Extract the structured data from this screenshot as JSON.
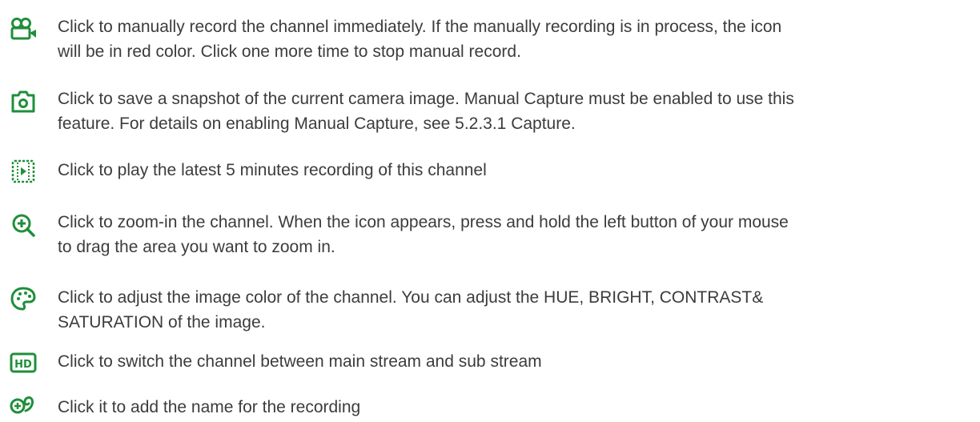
{
  "accent_color": "#1f8f3a",
  "items": [
    {
      "icon": "video-camera-record-icon",
      "text": "Click to manually record the channel immediately. If the manually recording is in process, the icon\nwill be in red color. Click one more time to stop manual record."
    },
    {
      "icon": "camera-snapshot-icon",
      "text": "Click to save a snapshot of the current camera image. Manual Capture must be enabled to use this\nfeature. For details on enabling Manual Capture, see 5.2.3.1 Capture."
    },
    {
      "icon": "instant-playback-icon",
      "text": "Click to play the latest 5 minutes recording of this channel"
    },
    {
      "icon": "zoom-in-icon",
      "text": "Click to zoom-in the channel. When the   icon appears, press and hold the left button of your mouse\nto drag the area you want to zoom in."
    },
    {
      "icon": "color-palette-icon",
      "text": "Click to adjust the image color of the channel. You can adjust the HUE, BRIGHT, CONTRAST&\nSATURATION of the image."
    },
    {
      "icon": "hd-stream-icon",
      "text": "Click to switch the channel between main stream and sub stream"
    },
    {
      "icon": "add-name-icon",
      "text": "Click it to add the name for the recording"
    }
  ]
}
